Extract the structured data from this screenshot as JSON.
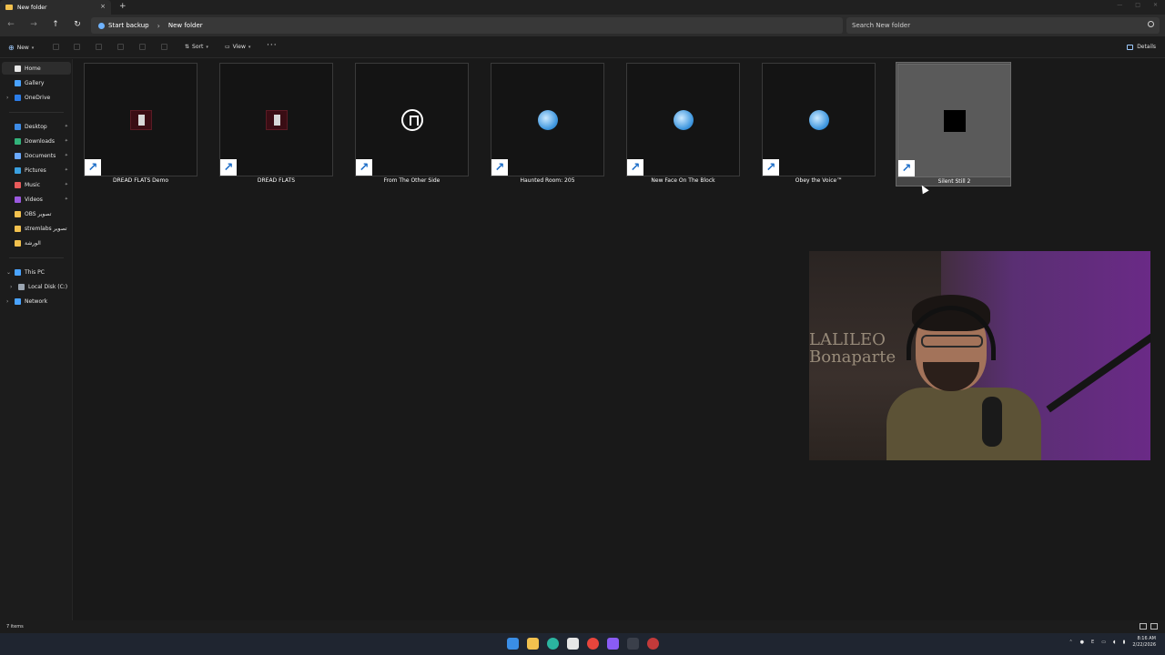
{
  "window": {
    "tab_title": "New folder",
    "new_tab_label": "+",
    "tab_close_label": "×"
  },
  "address": {
    "crumbs": [
      "Start backup",
      "New folder"
    ],
    "separator": "›",
    "search_placeholder": "Search New folder"
  },
  "commands": {
    "new_label": "New",
    "sort_label": "Sort",
    "view_label": "View",
    "more_label": "···",
    "details_label": "Details"
  },
  "sidebar": {
    "items": [
      {
        "label": "Home",
        "icon": "home-icon",
        "color": "#e8e8e8"
      },
      {
        "label": "Gallery",
        "icon": "gallery-icon",
        "color": "#4aa3ff"
      },
      {
        "label": "OneDrive",
        "icon": "onedrive-icon",
        "color": "#2b7de9"
      },
      {
        "label": "Desktop",
        "icon": "desktop-icon",
        "color": "#3d8be6"
      },
      {
        "label": "Downloads",
        "icon": "downloads-icon",
        "color": "#32b37a"
      },
      {
        "label": "Documents",
        "icon": "documents-icon",
        "color": "#6aa9ff"
      },
      {
        "label": "Pictures",
        "icon": "pictures-icon",
        "color": "#3aa0e0"
      },
      {
        "label": "Music",
        "icon": "music-icon",
        "color": "#e85b5b"
      },
      {
        "label": "Videos",
        "icon": "videos-icon",
        "color": "#9b59e0"
      },
      {
        "label": "OBS تصوير",
        "icon": "folder-icon",
        "color": "#f2c14e"
      },
      {
        "label": "stremlabs تصوير",
        "icon": "folder-icon",
        "color": "#f2c14e"
      },
      {
        "label": "الورشة",
        "icon": "folder-icon",
        "color": "#f2c14e"
      },
      {
        "label": "This PC",
        "icon": "pc-icon",
        "color": "#4aa3ff"
      },
      {
        "label": "Local Disk (C:)",
        "icon": "disk-icon",
        "color": "#9aa4b0"
      },
      {
        "label": "Network",
        "icon": "network-icon",
        "color": "#4aa3ff"
      }
    ]
  },
  "files": [
    {
      "name": "DREAD FLATS Demo",
      "icon": "dread-flats-icon"
    },
    {
      "name": "DREAD FLATS",
      "icon": "dread-flats-icon"
    },
    {
      "name": "From The Other Side",
      "icon": "from-other-side-icon"
    },
    {
      "name": "Haunted Room: 205",
      "icon": "globe-icon"
    },
    {
      "name": "New Face On The Block",
      "icon": "globe-icon"
    },
    {
      "name": "Obey the Voice™",
      "icon": "globe-icon"
    },
    {
      "name": "Silent Still 2",
      "icon": "silent-still-icon"
    }
  ],
  "shortcut_glyph": "↗",
  "webcam": {
    "painting_text_line1": "LALILEO",
    "painting_text_line2": "Bonaparte"
  },
  "status": {
    "item_count": "7 items"
  },
  "taskbar": {
    "time": "8:16 AM",
    "date": "2/22/2026",
    "lang": "E"
  }
}
